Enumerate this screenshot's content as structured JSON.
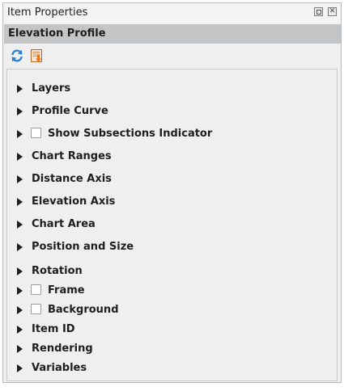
{
  "window": {
    "title": "Item Properties",
    "float_icon": "float-window-icon",
    "close_icon": "close-icon",
    "close_glyph": "✕"
  },
  "header": {
    "title": "Elevation Profile"
  },
  "toolbar": {
    "buttons": [
      {
        "icon": "refresh-icon"
      },
      {
        "icon": "export-data-icon"
      }
    ]
  },
  "sections": [
    {
      "label": "Layers",
      "checkbox": false
    },
    {
      "label": "Profile Curve",
      "checkbox": false
    },
    {
      "label": "Show Subsections Indicator",
      "checkbox": true,
      "checked": false
    },
    {
      "label": "Chart Ranges",
      "checkbox": false
    },
    {
      "label": "Distance Axis",
      "checkbox": false
    },
    {
      "label": "Elevation Axis",
      "checkbox": false
    },
    {
      "label": "Chart Area",
      "checkbox": false
    },
    {
      "label": "Position and Size",
      "checkbox": false
    },
    {
      "label": "Rotation",
      "checkbox": false
    },
    {
      "label": "Frame",
      "checkbox": true,
      "checked": false
    },
    {
      "label": "Background",
      "checkbox": true,
      "checked": false
    },
    {
      "label": "Item ID",
      "checkbox": false
    },
    {
      "label": "Rendering",
      "checkbox": false
    },
    {
      "label": "Variables",
      "checkbox": false
    }
  ],
  "colors": {
    "header_bg": "#c4c5c7",
    "panel_bg": "#efeff0",
    "refresh_blue": "#2b7fd3",
    "export_orange": "#e8741c"
  }
}
